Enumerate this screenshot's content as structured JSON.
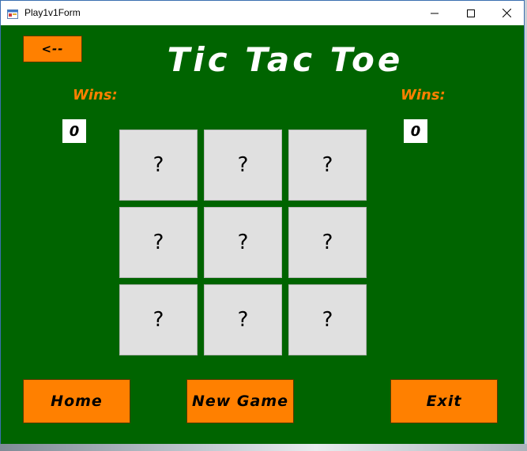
{
  "window": {
    "title": "Play1v1Form",
    "icon": "app-icon",
    "controls": {
      "minimize_icon": "minimize-icon",
      "maximize_icon": "maximize-icon",
      "close_icon": "close-icon"
    }
  },
  "header": {
    "back_label": "<--",
    "title": "Tic Tac Toe"
  },
  "players": {
    "left": {
      "wins_label": "Wins:",
      "score": "0"
    },
    "right": {
      "wins_label": "Wins:",
      "score": "0"
    }
  },
  "board": {
    "cells": [
      "?",
      "?",
      "?",
      "?",
      "?",
      "?",
      "?",
      "?",
      "?"
    ]
  },
  "footer": {
    "home_label": "Home",
    "new_game_label": "New Game",
    "exit_label": "Exit"
  },
  "colors": {
    "background": "#006400",
    "accent": "#ff8000",
    "title_text": "#ffffff",
    "cell": "#e0e0e0"
  }
}
